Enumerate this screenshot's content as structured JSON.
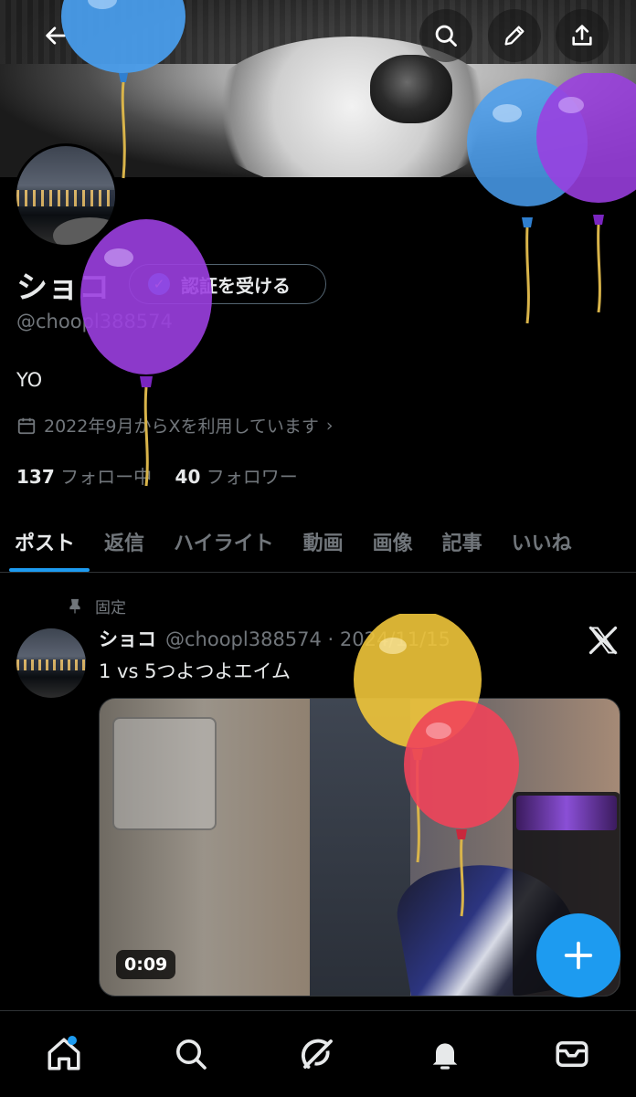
{
  "profile": {
    "name": "ショコ",
    "verify_label": "認証を受ける",
    "handle": "@choopl388574",
    "bio": "YO",
    "joined": "2022年9月からXを利用しています",
    "following_count": "137",
    "following_label": "フォロー中",
    "followers_count": "40",
    "followers_label": "フォロワー"
  },
  "tabs": [
    "ポスト",
    "返信",
    "ハイライト",
    "動画",
    "画像",
    "記事",
    "いいね"
  ],
  "pinned_post": {
    "pinned_label": "固定",
    "author": "ショコ",
    "handle_date": "@choopl388574 · 2024/11/15",
    "text": "1 vs 5つよつよエイム",
    "duration": "0:09"
  },
  "colors": {
    "accent": "#1d9bf0",
    "balloon_blue": "#4a9ff0",
    "balloon_purple": "#9b3fe0",
    "balloon_yellow": "#f0c53a",
    "balloon_red": "#f0445a"
  },
  "icons": {
    "header": [
      "back-arrow-icon",
      "search-icon",
      "pencil-icon",
      "share-icon"
    ],
    "bottom_nav": [
      "home-icon",
      "search-icon",
      "grok-icon",
      "bell-icon",
      "mail-icon"
    ]
  }
}
